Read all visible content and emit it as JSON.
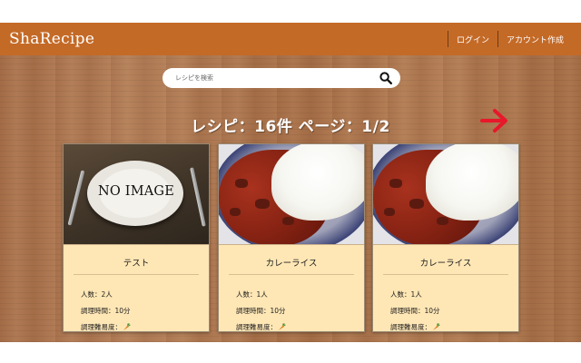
{
  "header": {
    "brand": "ShaRecipe",
    "nav": [
      "ログイン",
      "アカウント作成"
    ]
  },
  "search": {
    "placeholder": "レシピを検索",
    "icon": "search-icon"
  },
  "summary": "レシピ：16件 ページ：1/2",
  "next_arrow": {
    "icon": "arrow-right-icon",
    "color": "#e8172b"
  },
  "cards": [
    {
      "title": "テスト",
      "image_label": "NO IMAGE",
      "servings": "人数：2人",
      "time": "調理時間：10分",
      "difficulty": "調理難易度：",
      "difficulty_icon": "carrot-icon",
      "difficulty_level": 1
    },
    {
      "title": "カレーライス",
      "servings": "人数：1人",
      "time": "調理時間：10分",
      "difficulty": "調理難易度：",
      "difficulty_icon": "carrot-icon",
      "difficulty_level": 1
    },
    {
      "title": "カレーライス",
      "servings": "人数：1人",
      "time": "調理時間：10分",
      "difficulty": "調理難易度：",
      "difficulty_icon": "carrot-icon",
      "difficulty_level": 1
    }
  ],
  "colors": {
    "header": "#c46a27",
    "card": "#ffe7b5",
    "accent": "#e8172b"
  }
}
